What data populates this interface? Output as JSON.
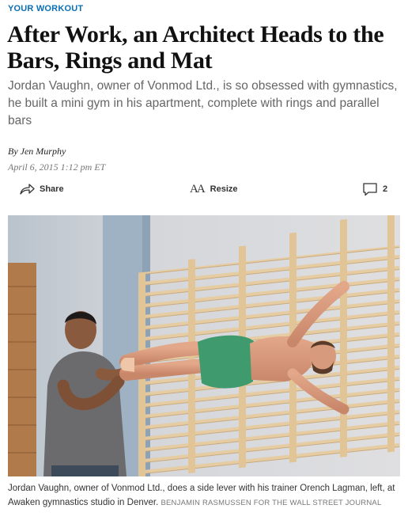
{
  "section": {
    "kicker": "YOUR WORKOUT"
  },
  "article": {
    "headline": "After Work, an Architect Heads to the Bars, Rings and Mat",
    "dek": "Jordan Vaughn, owner of Vonmod Ltd., is so obsessed with gymnastics, he built a mini gym in his apartment, complete with rings and parallel bars",
    "byline": "By Jen Murphy",
    "timestamp": "April 6, 2015 1:12 pm ET"
  },
  "toolbar": {
    "share_label": "Share",
    "resize_label": "Resize",
    "resize_glyph": "AA",
    "comments_count": "2",
    "icons": {
      "share": "share-arrow-icon",
      "resize": "text-resize-icon",
      "comments": "comment-bubble-icon"
    }
  },
  "photo": {
    "caption": "Jordan Vaughn, owner of Vonmod Ltd., does a side lever with his trainer Orench Lagman, left, at Awaken gymnastics studio in Denver.",
    "credit": "BENJAMIN RASMUSSEN FOR THE WALL STREET JOURNAL"
  },
  "colors": {
    "kicker": "#0a6fb3",
    "dek": "#666666",
    "wall": "#d9d9db",
    "wood": "#e8cfa5",
    "shorts": "#3f9a6e"
  }
}
